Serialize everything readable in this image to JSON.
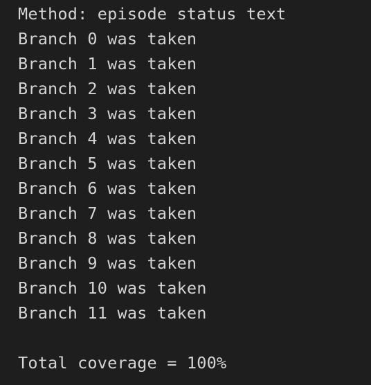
{
  "terminal": {
    "method_line": "Method: episode status text",
    "branches": [
      "Branch 0 was taken",
      "Branch 1 was taken",
      "Branch 2 was taken",
      "Branch 3 was taken",
      "Branch 4 was taken",
      "Branch 5 was taken",
      "Branch 6 was taken",
      "Branch 7 was taken",
      "Branch 8 was taken",
      "Branch 9 was taken",
      "Branch 10 was taken",
      "Branch 11 was taken"
    ],
    "total_line": "Total coverage = 100%"
  },
  "colors": {
    "background": "#1e1e1e",
    "text": "#d4d4d4"
  }
}
